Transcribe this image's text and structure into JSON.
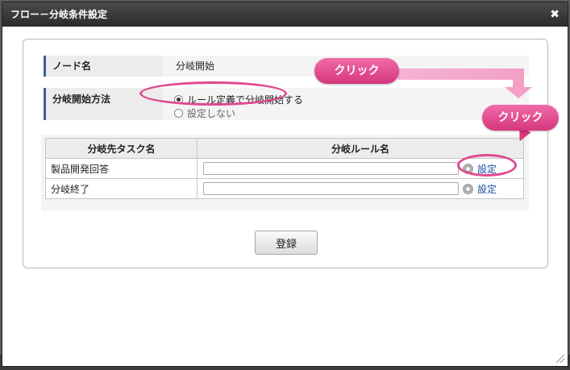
{
  "dialog": {
    "title": "フロー－分岐条件設定",
    "close_label": "✖"
  },
  "form": {
    "node_name_label": "ノード名",
    "node_name_value": "分岐開始",
    "method_label": "分岐開始方法",
    "method_option_1": "ルール定義で分岐開始する",
    "method_option_2": "設定しない",
    "method_selected": "ルール定義で分岐開始する"
  },
  "table": {
    "headers": [
      "分岐先タスク名",
      "分岐ルール名"
    ],
    "rows": [
      {
        "task": "製品開発回答",
        "rule_value": "",
        "action": "設定"
      },
      {
        "task": "分岐終了",
        "rule_value": "",
        "action": "設定"
      }
    ]
  },
  "buttons": {
    "register": "登録"
  },
  "annotations": {
    "callout_1": "クリック",
    "callout_2": "クリック",
    "accent_color": "#e0488f"
  }
}
